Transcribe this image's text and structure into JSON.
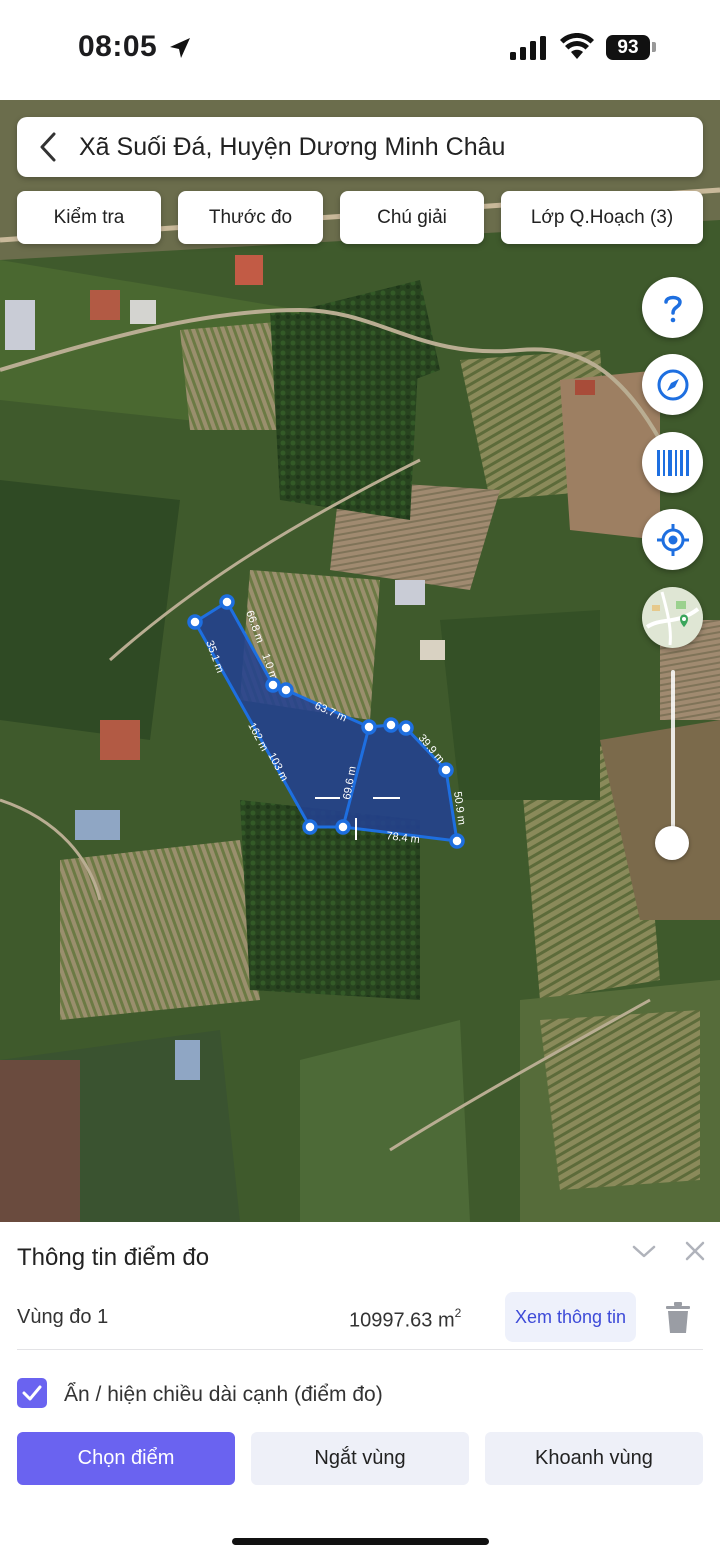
{
  "status": {
    "time": "08:05",
    "battery": "93"
  },
  "search": {
    "title": "Xã Suối Đá, Huyện Dương Minh Châu"
  },
  "toolbar": {
    "check": "Kiểm tra",
    "ruler": "Thước đo",
    "legend": "Chú giải",
    "layers": "Lớp Q.Hoạch (3)"
  },
  "map": {
    "edge_labels": [
      "35.1 m",
      "66.8 m",
      "1.0 m",
      "63.7 m",
      "39.9 m",
      "50.9 m",
      "78.4 m",
      "69.6 m",
      "162 m",
      "103 m"
    ],
    "polygon_color": "#23418f",
    "vertex_color": "#1e6fe0"
  },
  "fabs": [
    "help-icon",
    "compass-icon",
    "barcode-icon",
    "locate-icon",
    "map-style-icon"
  ],
  "panel": {
    "title": "Thông tin điểm đo",
    "area_label": "Vùng đo 1",
    "area_value": "10997.63 m",
    "area_unit_sup": "2",
    "view_info": "Xem thông tin",
    "toggle_label": "Ẩn / hiện chiều dài cạnh (điểm đo)",
    "toggle_checked": true,
    "buttons": {
      "pick_point": "Chọn điểm",
      "split": "Ngắt vùng",
      "draw": "Khoanh vùng"
    }
  },
  "colors": {
    "accent": "#6a63f0",
    "link": "#3d4ad8"
  }
}
